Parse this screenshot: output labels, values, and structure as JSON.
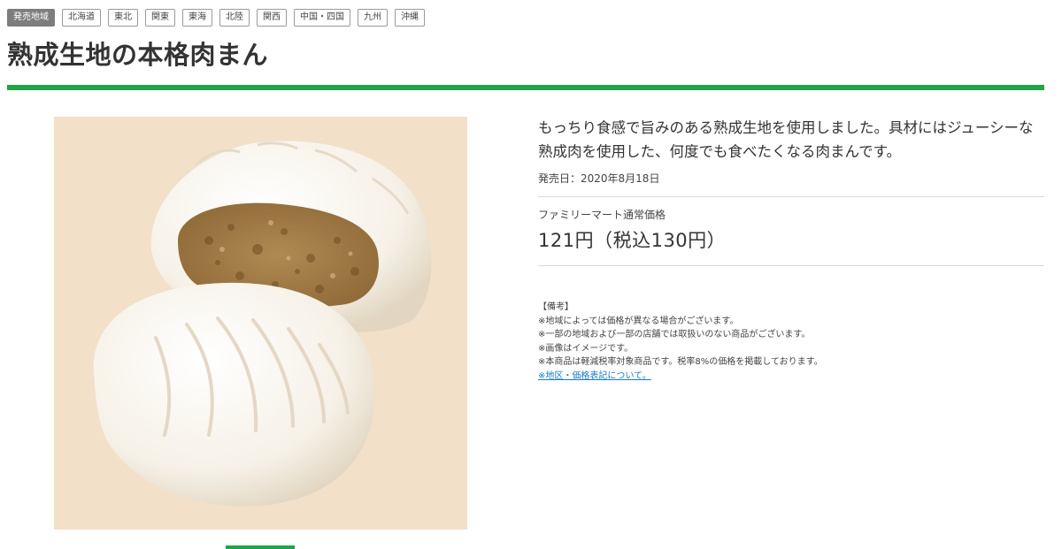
{
  "regions": {
    "label": "発売地域",
    "items": [
      "北海道",
      "東北",
      "関東",
      "東海",
      "北陸",
      "関西",
      "中国・四国",
      "九州",
      "沖縄"
    ]
  },
  "product": {
    "title": "熟成生地の本格肉まん",
    "description": "もっちり食感で旨みのある熟成生地を使用しました。具材にはジューシーな熟成肉を使用した、何度でも食べたくなる肉まんです。",
    "release_date": "発売日：2020年8月18日",
    "price_label": "ファミリーマート通常価格",
    "price": "121円（税込130円）"
  },
  "notes": {
    "heading": "【備考】",
    "lines": [
      "※地域によっては価格が異なる場合がございます。",
      "※一部の地域および一部の店舗では取扱いのない商品がございます。",
      "※画像はイメージです。",
      "※本商品は軽減税率対象商品です。税率8%の価格を掲載しております。"
    ],
    "link": "※地区・価格表記について。"
  },
  "colors": {
    "accent_green": "#1fa547",
    "image_background": "#f2e0c8",
    "link_blue": "#1a79c4"
  }
}
